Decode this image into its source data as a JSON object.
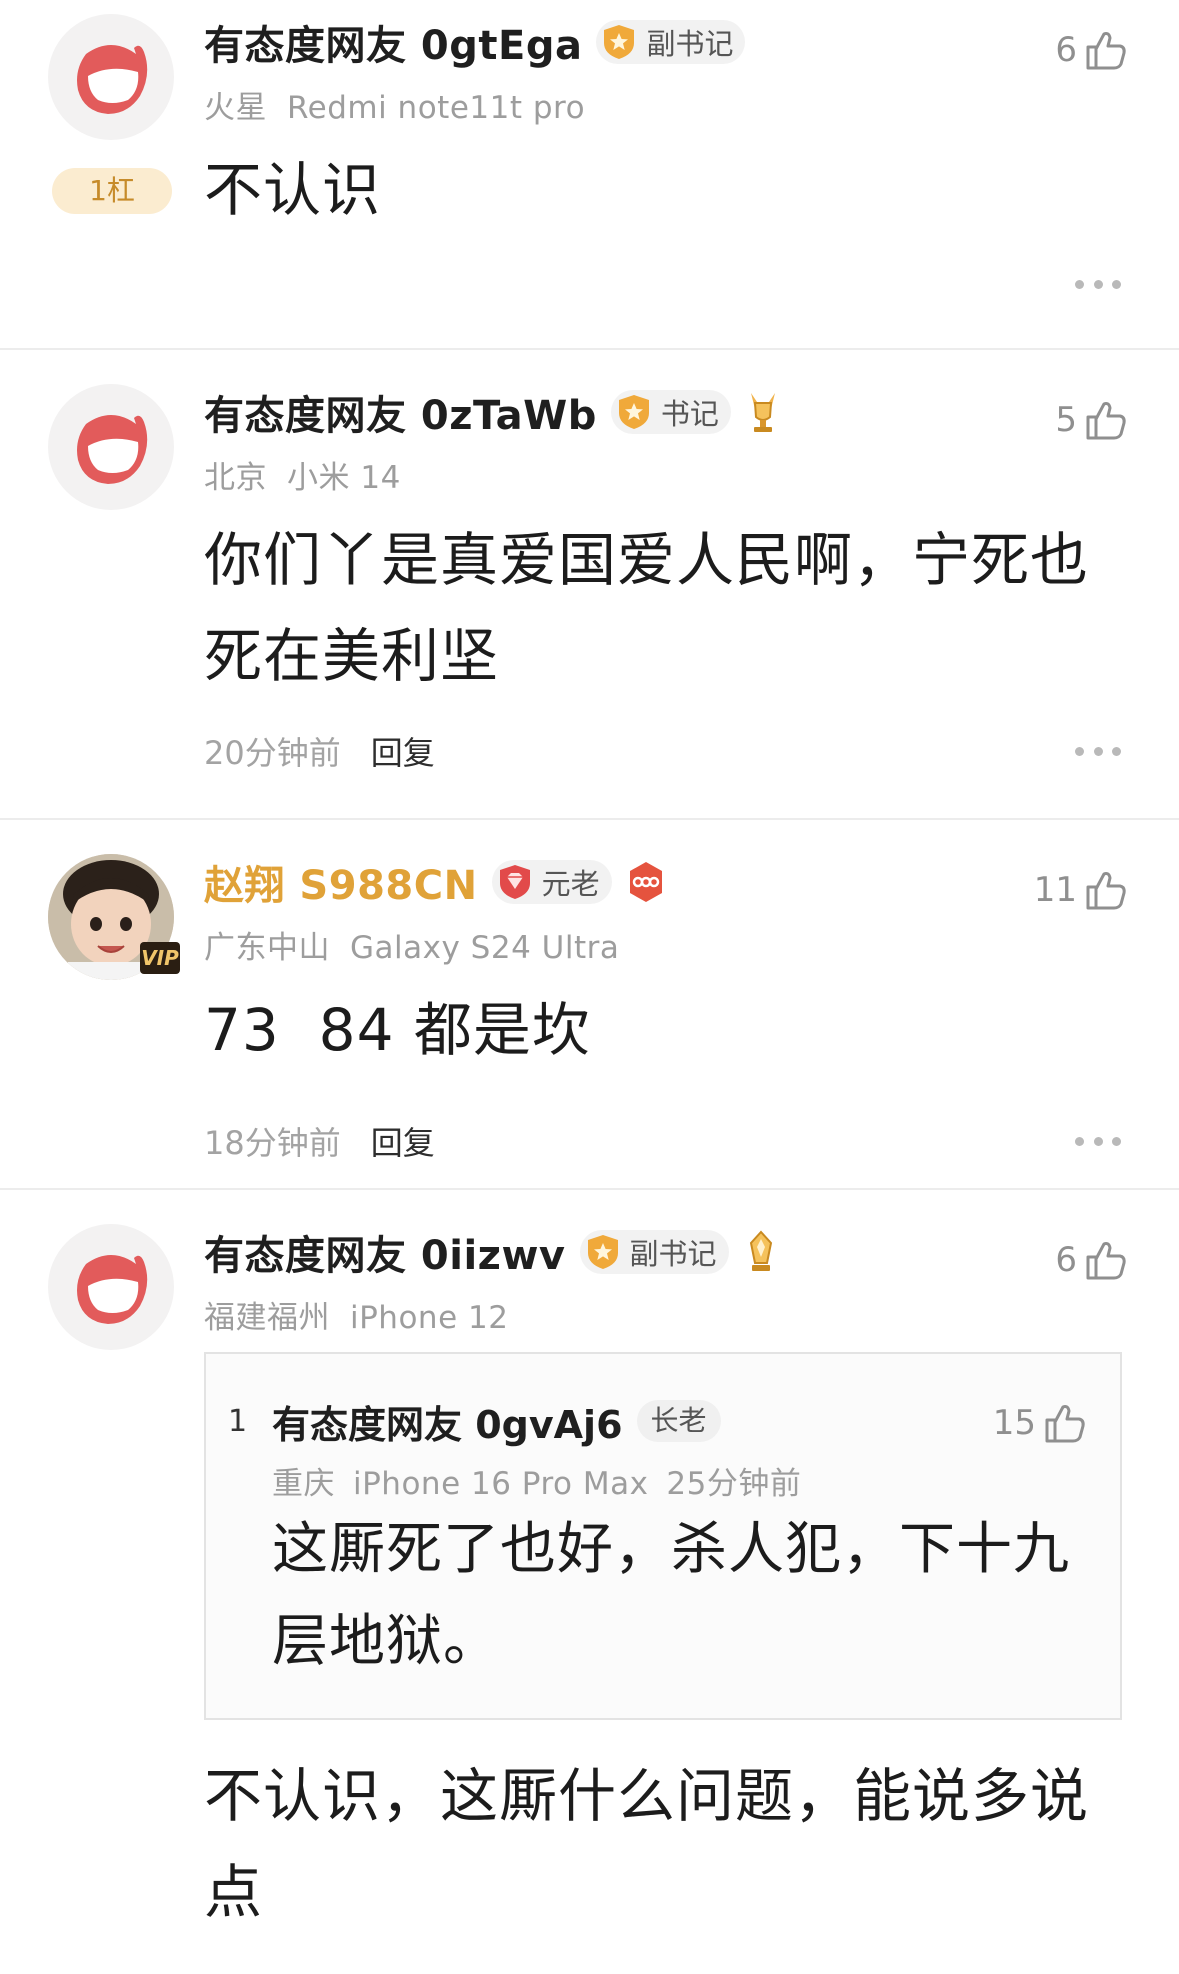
{
  "comments": [
    {
      "username": "有态度网友 0gtEga",
      "title_badge": "副书记",
      "location": "火星",
      "device": "Redmi note11t pro",
      "likes": "6",
      "rank_badge": "1杠",
      "text": "不认识"
    },
    {
      "username": "有态度网友 0zTaWb",
      "title_badge": "书记",
      "location": "北京",
      "device": "小米 14",
      "likes": "5",
      "text": "你们丫是真爱国爱人民啊，宁死也死在美利坚",
      "time": "20分钟前",
      "reply_label": "回复"
    },
    {
      "username": "赵翔 S988CN",
      "title_badge": "元老",
      "location": "广东中山",
      "device": "Galaxy S24 Ultra",
      "likes": "11",
      "vip_label": "VIP",
      "text": "73  84 都是坎",
      "time": "18分钟前",
      "reply_label": "回复"
    },
    {
      "username": "有态度网友 0iizwv",
      "title_badge": "副书记",
      "location": "福建福州",
      "device": "iPhone 12",
      "likes": "6",
      "text": "不认识，这厮什么问题，能说多说点",
      "quote": {
        "index": "1",
        "username": "有态度网友 0gvAj6",
        "badge": "长老",
        "location": "重庆",
        "device": "iPhone 16 Pro Max",
        "time": "25分钟前",
        "likes": "15",
        "text": "这厮死了也好，杀人犯，下十九层地狱。"
      }
    }
  ],
  "colors": {
    "gold_username": "#e0a238",
    "rank_badge_bg": "#fbecd0",
    "logo_red": "#e25b5b"
  },
  "icons": {
    "like": "thumbs-up-icon",
    "more": "more-dots-icon",
    "app_logo": "app-logo-icon",
    "title_star": "star-shield-icon",
    "trophy": "trophy-icon",
    "gem": "gem-shield-icon",
    "anniversary": "anniversary-badge-icon"
  }
}
